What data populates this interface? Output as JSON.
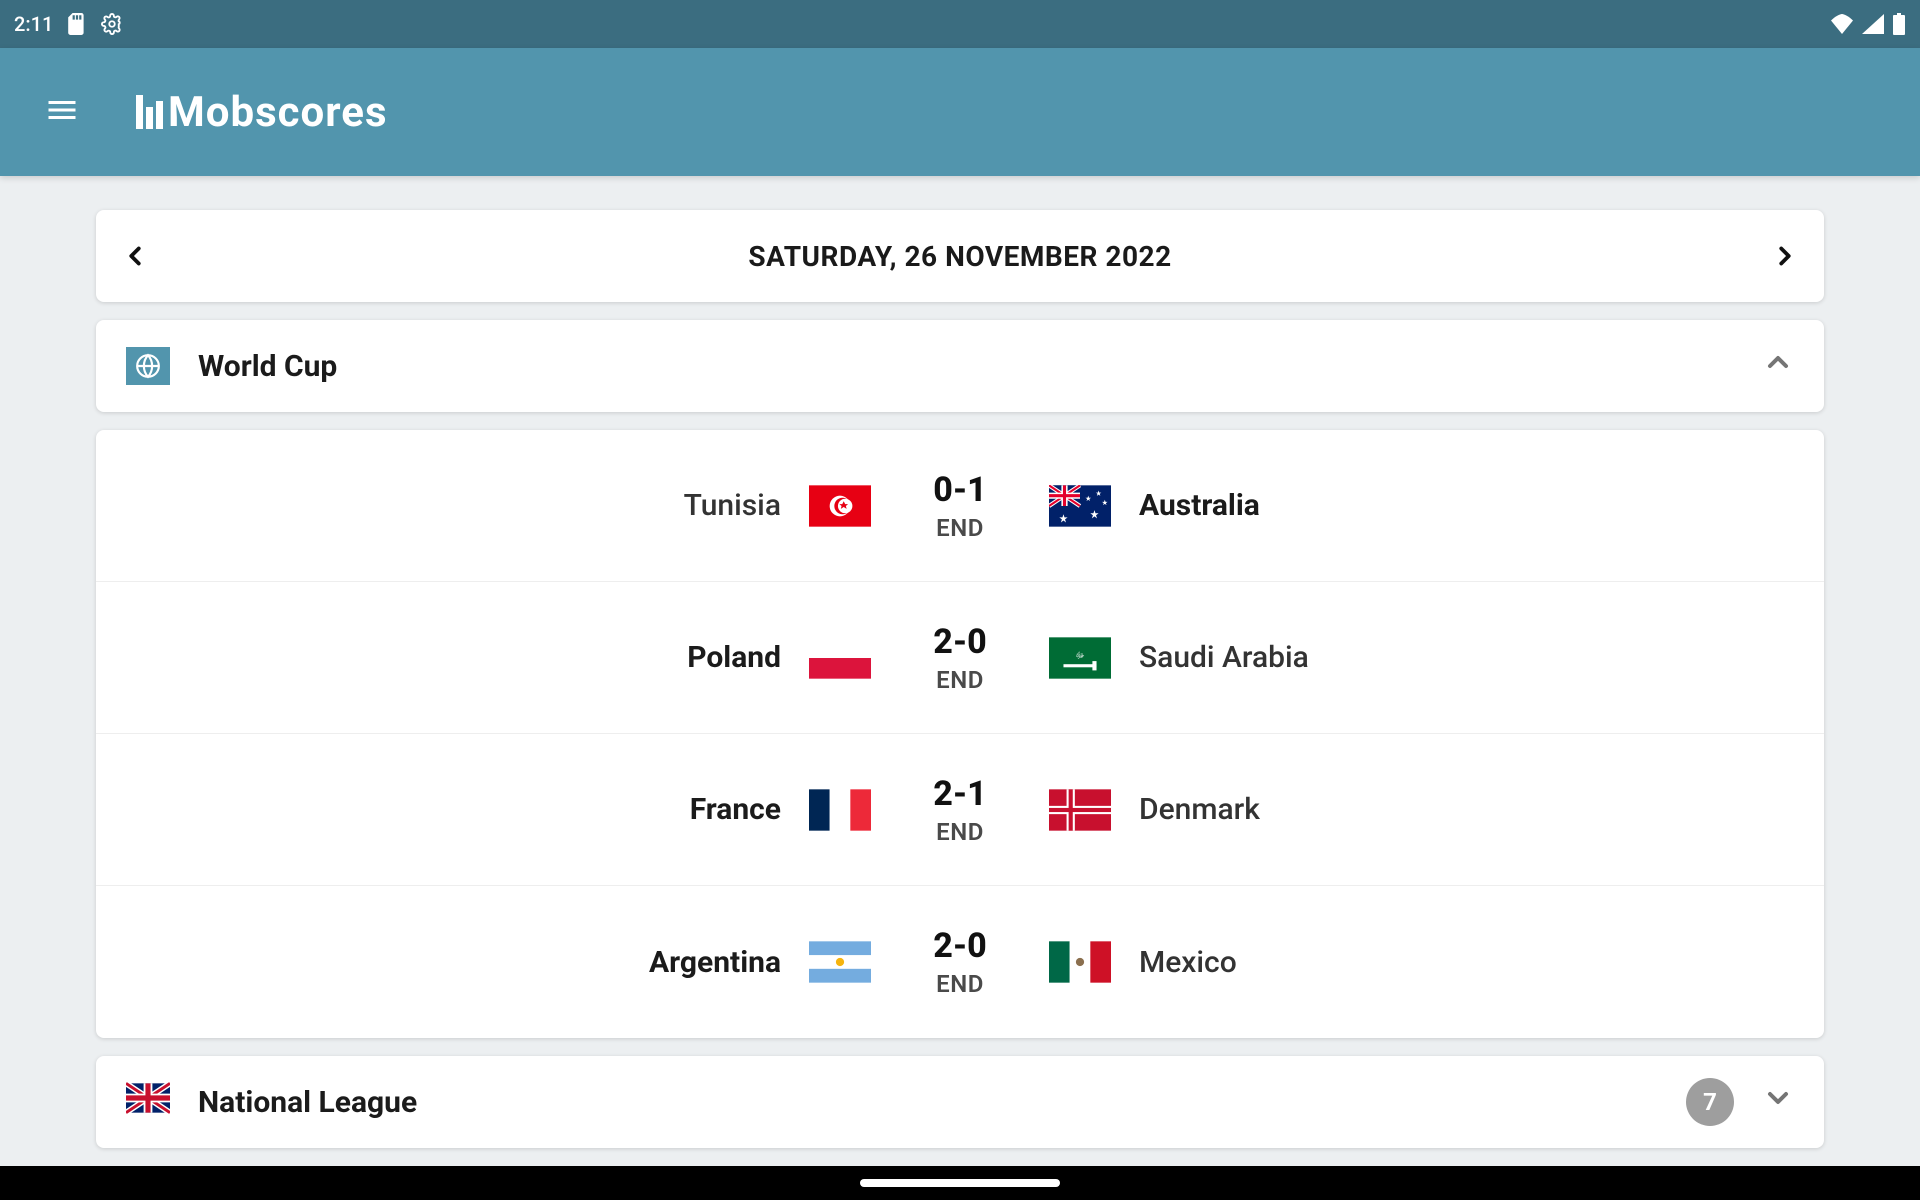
{
  "status_bar": {
    "time": "2:11"
  },
  "app": {
    "name": "Mobscores"
  },
  "date_nav": {
    "label": "SATURDAY, 26 NOVEMBER 2022"
  },
  "competitions": [
    {
      "id": "world-cup",
      "name": "World Cup",
      "icon": "globe",
      "expanded": true,
      "matches": [
        {
          "home": "Tunisia",
          "home_flag": "TN",
          "away": "Australia",
          "away_flag": "AU",
          "score": "0-1",
          "status": "END",
          "winner": "away"
        },
        {
          "home": "Poland",
          "home_flag": "PL",
          "away": "Saudi Arabia",
          "away_flag": "SA",
          "score": "2-0",
          "status": "END",
          "winner": "home"
        },
        {
          "home": "France",
          "home_flag": "FR",
          "away": "Denmark",
          "away_flag": "DK",
          "score": "2-1",
          "status": "END",
          "winner": "home"
        },
        {
          "home": "Argentina",
          "home_flag": "AR",
          "away": "Mexico",
          "away_flag": "MX",
          "score": "2-0",
          "status": "END",
          "winner": "home"
        }
      ]
    },
    {
      "id": "national-league",
      "name": "National League",
      "icon": "flag-gb",
      "expanded": false,
      "match_count": "7"
    }
  ]
}
